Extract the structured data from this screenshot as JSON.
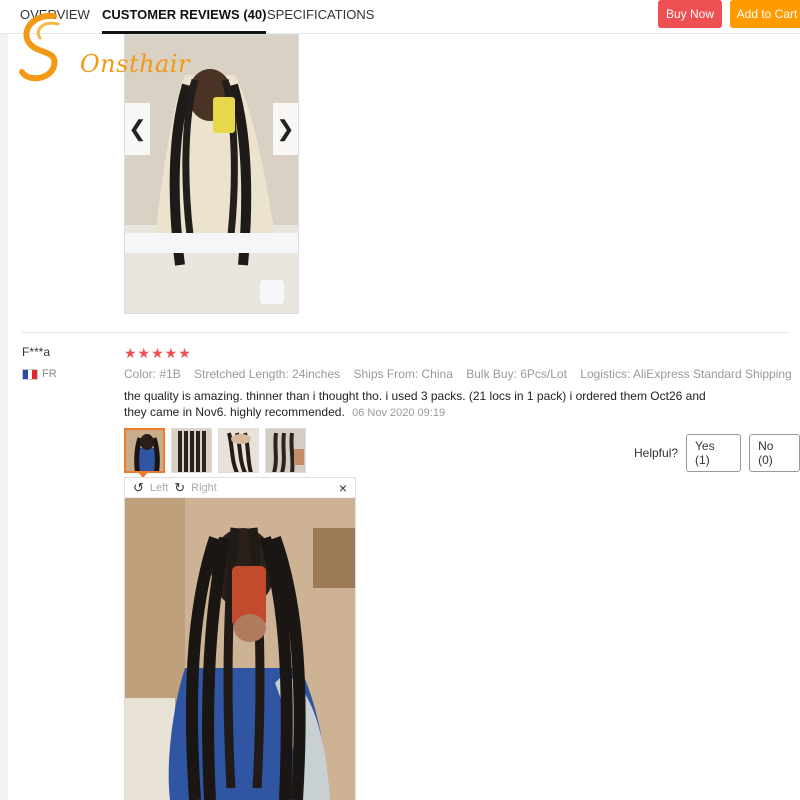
{
  "tabs": [
    {
      "label": "OVERVIEW"
    },
    {
      "label": "CUSTOMER REVIEWS (40)"
    },
    {
      "label": "SPECIFICATIONS"
    }
  ],
  "actions": {
    "buy_now": "Buy Now",
    "add_to_cart": "Add to Cart"
  },
  "brand": {
    "logo_text": "Onsthair",
    "accent_color": "#f29a15"
  },
  "previous_review": {
    "nav_prev_icon": "chevron-left-icon",
    "nav_next_icon": "chevron-right-icon"
  },
  "review": {
    "reviewer": "F***a",
    "country": "FR",
    "rating": 5,
    "stars": "★★★★★",
    "attributes": [
      "Color: #1B",
      "Stretched Length: 24inches",
      "Ships From: China",
      "Bulk Buy: 6Pcs/Lot",
      "Logistics: AliExpress Standard Shipping"
    ],
    "text": "the quality is amazing. thinner than i thought tho. i used 3 packs. (21 locs in 1 pack) i ordered them Oct26 and they came in Nov6. highly recommended.",
    "date": "06 Nov 2020 09:19",
    "thumbnail_count": 4,
    "helpful_label": "Helpful?",
    "yes_label": "Yes (1)",
    "no_label": "No (0)"
  },
  "viewer": {
    "rotate_left": "Left",
    "rotate_right": "Right",
    "close": "×"
  },
  "colors": {
    "buy_now": "#ee4f52",
    "add_to_cart": "#ff9a00",
    "stars": "#ee4f52",
    "selected_thumb": "#ee7a2b"
  }
}
